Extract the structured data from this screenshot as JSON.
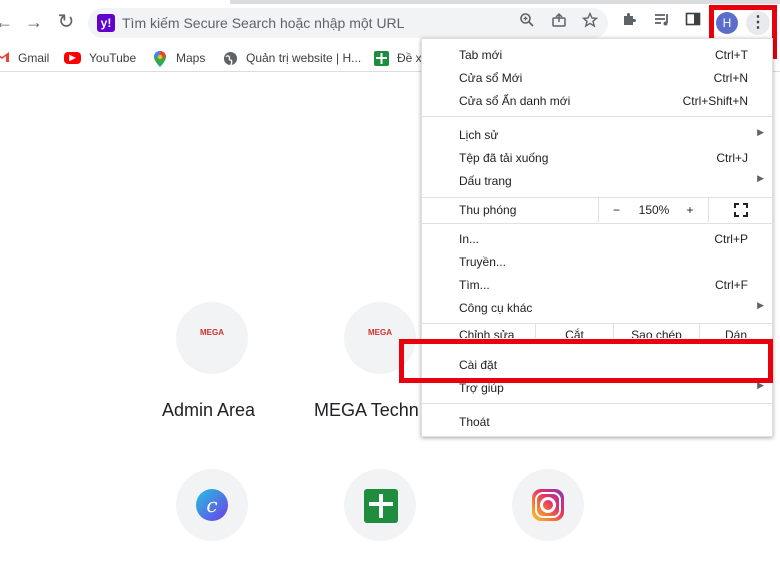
{
  "toolbar": {
    "back_glyph": "←",
    "forward_glyph": "→",
    "reload_glyph": "↻",
    "omnibox_placeholder": "Tìm kiếm Secure Search hoặc nhập một URL",
    "search_badge": "y!",
    "profile_initial": "H",
    "menu_glyph": "⋮"
  },
  "bookmarks": [
    {
      "label": "Gmail",
      "icon": "gmail-icon"
    },
    {
      "label": "YouTube",
      "icon": "youtube-icon"
    },
    {
      "label": "Maps",
      "icon": "maps-icon"
    },
    {
      "label": "Quản trị website | H...",
      "icon": "globe-icon"
    },
    {
      "label": "Đề x",
      "icon": "sheets-icon"
    }
  ],
  "shortcuts": [
    {
      "label": "Admin Area",
      "logo_text": "MEGA"
    },
    {
      "label": "MEGA Techn",
      "logo_text": "MEGA"
    },
    {
      "label": "",
      "logo_text": "c"
    },
    {
      "label": "",
      "logo_text": ""
    },
    {
      "label": "",
      "logo_text": ""
    }
  ],
  "menu": {
    "new_tab": {
      "label": "Tab mới",
      "shortcut": "Ctrl+T"
    },
    "new_window": {
      "label": "Cửa sổ Mới",
      "shortcut": "Ctrl+N"
    },
    "incognito": {
      "label": "Cửa sổ Ẩn danh mới",
      "shortcut": "Ctrl+Shift+N"
    },
    "history": {
      "label": "Lịch sử"
    },
    "downloads": {
      "label": "Tệp đã tải xuống",
      "shortcut": "Ctrl+J"
    },
    "bookmarks": {
      "label": "Dấu trang"
    },
    "zoom": {
      "label": "Thu phóng",
      "minus": "−",
      "value": "150%",
      "plus": "+"
    },
    "print": {
      "label": "In...",
      "shortcut": "Ctrl+P"
    },
    "cast": {
      "label": "Truyền..."
    },
    "find": {
      "label": "Tìm...",
      "shortcut": "Ctrl+F"
    },
    "more_tools": {
      "label": "Công cụ khác"
    },
    "edit": {
      "label": "Chỉnh sửa",
      "cut": "Cắt",
      "copy": "Sao chép",
      "paste": "Dán"
    },
    "settings": {
      "label": "Cài đặt"
    },
    "help": {
      "label": "Trợ giúp"
    },
    "exit": {
      "label": "Thoát"
    }
  },
  "colors": {
    "highlight": "#e8000c",
    "avatar": "#5b6ec9",
    "yahoo": "#6001d2"
  }
}
